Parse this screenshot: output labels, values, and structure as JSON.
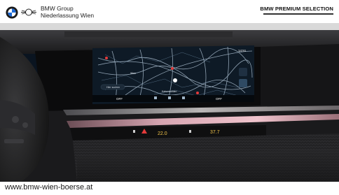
{
  "header": {
    "brand_logo": "bmw-roundel-icon",
    "partner_logo": "mini-wings-icon",
    "dealer_line1": "BMW Group",
    "dealer_line2": "Niederlassung Wien",
    "premium_label": "BMW PREMIUM SELECTION"
  },
  "screen": {
    "clock": "14:51",
    "search_label": "Hier suchen",
    "hvac_left": "OFF",
    "hvac_right": "OFF",
    "map_label_1": "Kaisermühlen",
    "map_label_2": "Wien"
  },
  "console": {
    "display_1": "22.0",
    "display_2": "37.7"
  },
  "footer": {
    "url": "www.bmw-wien-boerse.at"
  },
  "colors": {
    "screen_bg": "#0e1a26",
    "map_road": "#a9bccd",
    "accent_red": "#e33a3a",
    "amber": "#f2c44a"
  }
}
